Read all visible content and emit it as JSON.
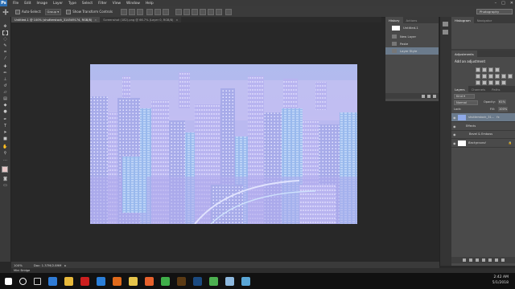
{
  "menubar": {
    "logo": "Ps",
    "items": [
      "File",
      "Edit",
      "Image",
      "Layer",
      "Type",
      "Select",
      "Filter",
      "View",
      "Window",
      "Help"
    ],
    "min": "–",
    "max": "□",
    "close": "✕"
  },
  "options": {
    "auto_select_label": "Auto-Select:",
    "auto_select_value": "Group",
    "transform_label": "Show Transform Controls",
    "workspace": "Photography"
  },
  "tabs": [
    {
      "label": "Untitled-1 @ 100% (shutterstock_314549174, RGB/8)",
      "close": "×"
    },
    {
      "label": "Screenshot (182).png @ 66.7% (Layer 0, RGB/8)",
      "close": "×"
    }
  ],
  "history": {
    "tabs": [
      "History",
      "Actions"
    ],
    "snapshot": "Untitled-1",
    "items": [
      "New Layer",
      "Paste",
      "Layer Style"
    ]
  },
  "right": {
    "tabs_top": [
      "Histogram",
      "Navigator"
    ],
    "adjustments_tab": "Adjustments",
    "adjust_heading": "Add an adjustment",
    "layers_tabs": [
      "Layers",
      "Channels",
      "Paths"
    ],
    "kind": "Kind",
    "blend_mode": "Normal",
    "opacity_label": "Opacity:",
    "opacity_value": "61%",
    "lock_label": "Lock:",
    "fill_label": "Fill:",
    "fill_value": "100%",
    "layers": [
      {
        "name": "shutterstock_31...",
        "fx": "fx"
      },
      {
        "name": "Effects"
      },
      {
        "name": "Bevel & Emboss"
      },
      {
        "name": "Background"
      }
    ]
  },
  "status": {
    "zoom": "100%",
    "doc": "Doc: 1.37M/2.89M"
  },
  "minibridge": "Mini Bridge",
  "clock": {
    "time": "2:42 AM",
    "date": "5/1/2018"
  },
  "taskbar_icons": [
    {
      "name": "windows",
      "color": "#ffffff"
    },
    {
      "name": "search",
      "color": "#ffffff"
    },
    {
      "name": "task-view",
      "color": "#cccccc"
    },
    {
      "name": "edge",
      "color": "#2f7bd5"
    },
    {
      "name": "file-explorer",
      "color": "#e8b93a"
    },
    {
      "name": "acrobat",
      "color": "#cc1f1f"
    },
    {
      "name": "store",
      "color": "#2a7ed8"
    },
    {
      "name": "media-player",
      "color": "#e06a1b"
    },
    {
      "name": "photos",
      "color": "#e6c44a"
    },
    {
      "name": "firefox",
      "color": "#e7612c"
    },
    {
      "name": "green-app",
      "color": "#3fae49"
    },
    {
      "name": "illustrator",
      "color": "#5b3a14"
    },
    {
      "name": "photoshop",
      "color": "#1b4a80"
    },
    {
      "name": "chrome",
      "color": "#4caf50"
    },
    {
      "name": "notepad",
      "color": "#8db8de"
    },
    {
      "name": "paint",
      "color": "#5aa6d6"
    }
  ]
}
